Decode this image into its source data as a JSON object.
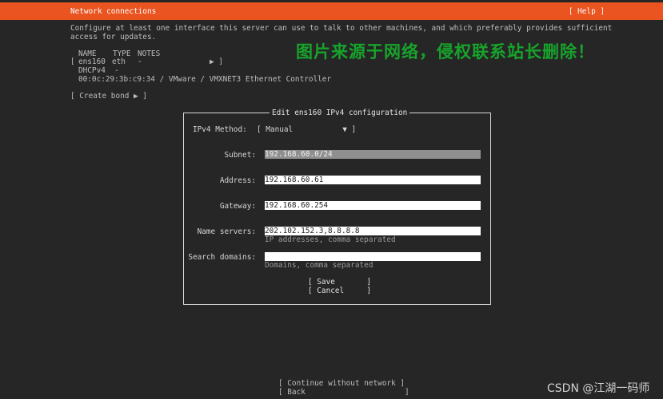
{
  "header": {
    "title": "Network connections",
    "help": "[ Help ]"
  },
  "intro": {
    "line1": "Configure at least one interface this server can use to talk to other machines, and which preferably provides sufficient",
    "line2": "access for updates."
  },
  "table": {
    "headers": [
      "NAME",
      "TYPE",
      "NOTES"
    ],
    "row": {
      "open": "[",
      "name": "ens160",
      "type": "eth",
      "notes": "-",
      "arrow": "▶ ]"
    },
    "dhcp": "DHCPv4  -",
    "mac": "00:0c:29:3b:c9:34 / VMware / VMXNET3 Ethernet Controller"
  },
  "create_bond": "[ Create bond ▶ ]",
  "dialog": {
    "title": "Edit ens160 IPv4 configuration",
    "method_label": "IPv4 Method:",
    "method_value": "[ Manual           ▼ ]",
    "subnet_label": "Subnet:",
    "subnet_value": "192.168.60.0/24",
    "address_label": "Address:",
    "address_value": "192.168.60.61",
    "gateway_label": "Gateway:",
    "gateway_value": "192.168.60.254",
    "nameservers_label": "Name servers:",
    "nameservers_value": "202.102.152.3,8.8.8.8",
    "nameservers_hint": "IP addresses, comma separated",
    "search_label": "Search domains:",
    "search_value": "",
    "search_hint": "Domains, comma separated",
    "save": "[ Save       ]",
    "cancel": "[ Cancel     ]"
  },
  "footer": {
    "continue": "[ Continue without network ]",
    "back": "[ Back                      ]"
  },
  "watermark": "图片来源于网络，侵权联系站长删除！",
  "csdn": "CSDN @江湖一码师",
  "colors": {
    "accent": "#e95420",
    "background": "#262626",
    "watermark": "#17a32b"
  }
}
